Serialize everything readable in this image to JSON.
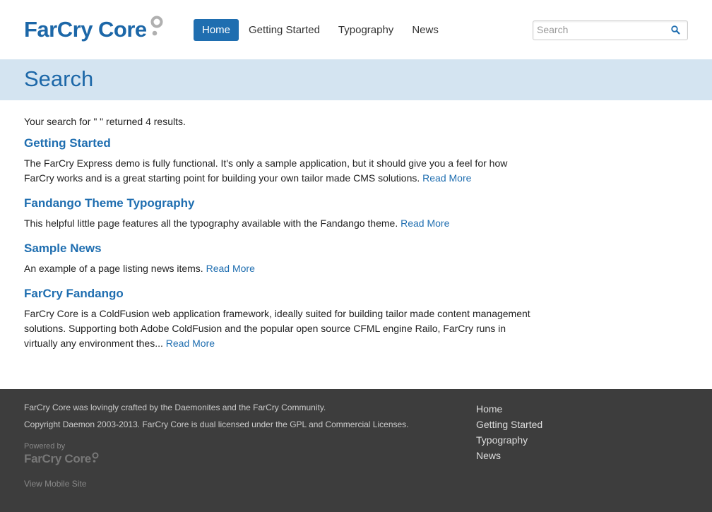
{
  "brand": {
    "name": "FarCry Core",
    "color": "#1c67a8"
  },
  "nav": {
    "items": [
      {
        "label": "Home",
        "active": true
      },
      {
        "label": "Getting Started",
        "active": false
      },
      {
        "label": "Typography",
        "active": false
      },
      {
        "label": "News",
        "active": false
      }
    ]
  },
  "search": {
    "placeholder": "Search",
    "icon": "search-icon"
  },
  "page": {
    "title": "Search"
  },
  "results": {
    "summary": "Your search for \" \" returned 4 results.",
    "items": [
      {
        "title": "Getting Started",
        "text": "The FarCry Express demo is fully functional. It's only a sample application, but it should give you a feel for how FarCry works and is a great starting point for building your own tailor made CMS solutions.",
        "read_more": "Read More"
      },
      {
        "title": "Fandango Theme Typography",
        "text": "This helpful little page features all the typography available with the Fandango theme.",
        "read_more": "Read More"
      },
      {
        "title": "Sample News",
        "text": "An example of a page listing news items.",
        "read_more": "Read More"
      },
      {
        "title": "FarCry Fandango",
        "text": "FarCry Core is a ColdFusion web application framework, ideally suited for building tailor made content management solutions. Supporting both Adobe ColdFusion and the popular open source CFML engine Railo, FarCry runs in virtually any environment thes...",
        "read_more": "Read More"
      }
    ]
  },
  "footer": {
    "credit": "FarCry Core was lovingly crafted by the Daemonites and the FarCry Community.",
    "copyright": "Copyright Daemon 2003-2013. FarCry Core is dual licensed under the GPL and Commercial Licenses.",
    "powered_by": "Powered by",
    "powered_logo": "FarCry Core",
    "mobile_link": "View Mobile Site",
    "links": [
      "Home",
      "Getting Started",
      "Typography",
      "News"
    ]
  }
}
